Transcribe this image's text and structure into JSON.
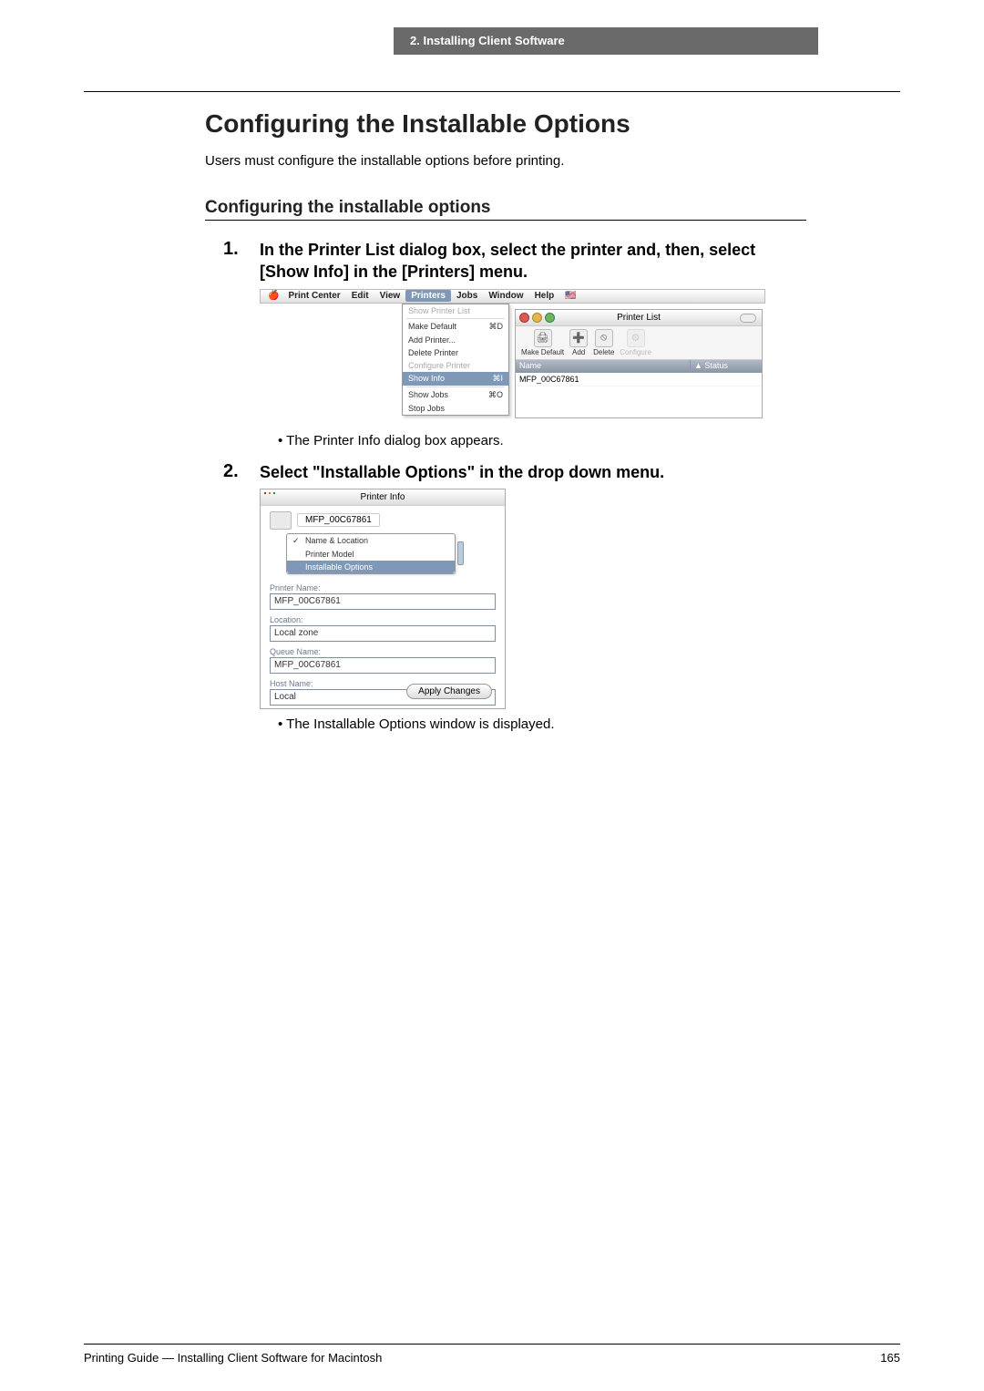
{
  "header_bar": "2.  Installing Client Software",
  "main_heading": "Configuring the Installable Options",
  "intro_text": "Users must configure the installable options before printing.",
  "sub_heading": "Configuring the installable options",
  "step1_num": "1.",
  "step1_text": "In the Printer List dialog box, select the printer and, then, select [Show Info] in the [Printers] menu.",
  "shot1": {
    "menubar": {
      "app": "Print Center",
      "items": [
        "Edit",
        "View",
        "Printers",
        "Jobs",
        "Window",
        "Help"
      ],
      "selected": "Printers"
    },
    "dropdown": {
      "items": [
        {
          "label": "Show Printer List",
          "key": "",
          "disabled": true
        },
        {
          "label": "Make Default",
          "key": "⌘D"
        },
        {
          "label": "Add Printer...",
          "key": ""
        },
        {
          "label": "Delete Printer",
          "key": ""
        },
        {
          "label": "Configure Printer",
          "key": "",
          "disabled": true
        },
        {
          "label": "Show Info",
          "key": "⌘I",
          "highlight": true
        },
        {
          "label": "Show Jobs",
          "key": "⌘O"
        },
        {
          "label": "Stop Jobs",
          "key": ""
        }
      ]
    },
    "printerlist": {
      "title": "Printer List",
      "toolbar": [
        {
          "name": "Make Default",
          "glyph": "🖨"
        },
        {
          "name": "Add",
          "glyph": "➕"
        },
        {
          "name": "Delete",
          "glyph": "⦸"
        },
        {
          "name": "Configure",
          "glyph": "⚙",
          "disabled": true
        }
      ],
      "col1": "Name",
      "col2": "▲ Status",
      "row": "MFP_00C67861"
    }
  },
  "note1": "The Printer Info dialog box appears.",
  "step2_num": "2.",
  "step2_text": "Select \"Installable Options\" in the drop down menu.",
  "shot2": {
    "title": "Printer Info",
    "crumb": "MFP_00C67861",
    "dropdown": [
      {
        "chk": "✓",
        "label": "Name & Location"
      },
      {
        "chk": "",
        "label": "Printer Model"
      },
      {
        "chk": "",
        "label": "Installable Options",
        "hl": true
      }
    ],
    "printer_name_label": "Printer Name:",
    "printer_name_val": "MFP_00C67861",
    "location_label": "Location:",
    "location_val": "Local zone",
    "queue_label": "Queue Name:",
    "queue_val": "MFP_00C67861",
    "host_label": "Host Name:",
    "host_val": "Local",
    "apply": "Apply Changes"
  },
  "note2": "The Installable Options window is displayed.",
  "footer_left": "Printing Guide — Installing Client Software for Macintosh",
  "footer_right": "165"
}
